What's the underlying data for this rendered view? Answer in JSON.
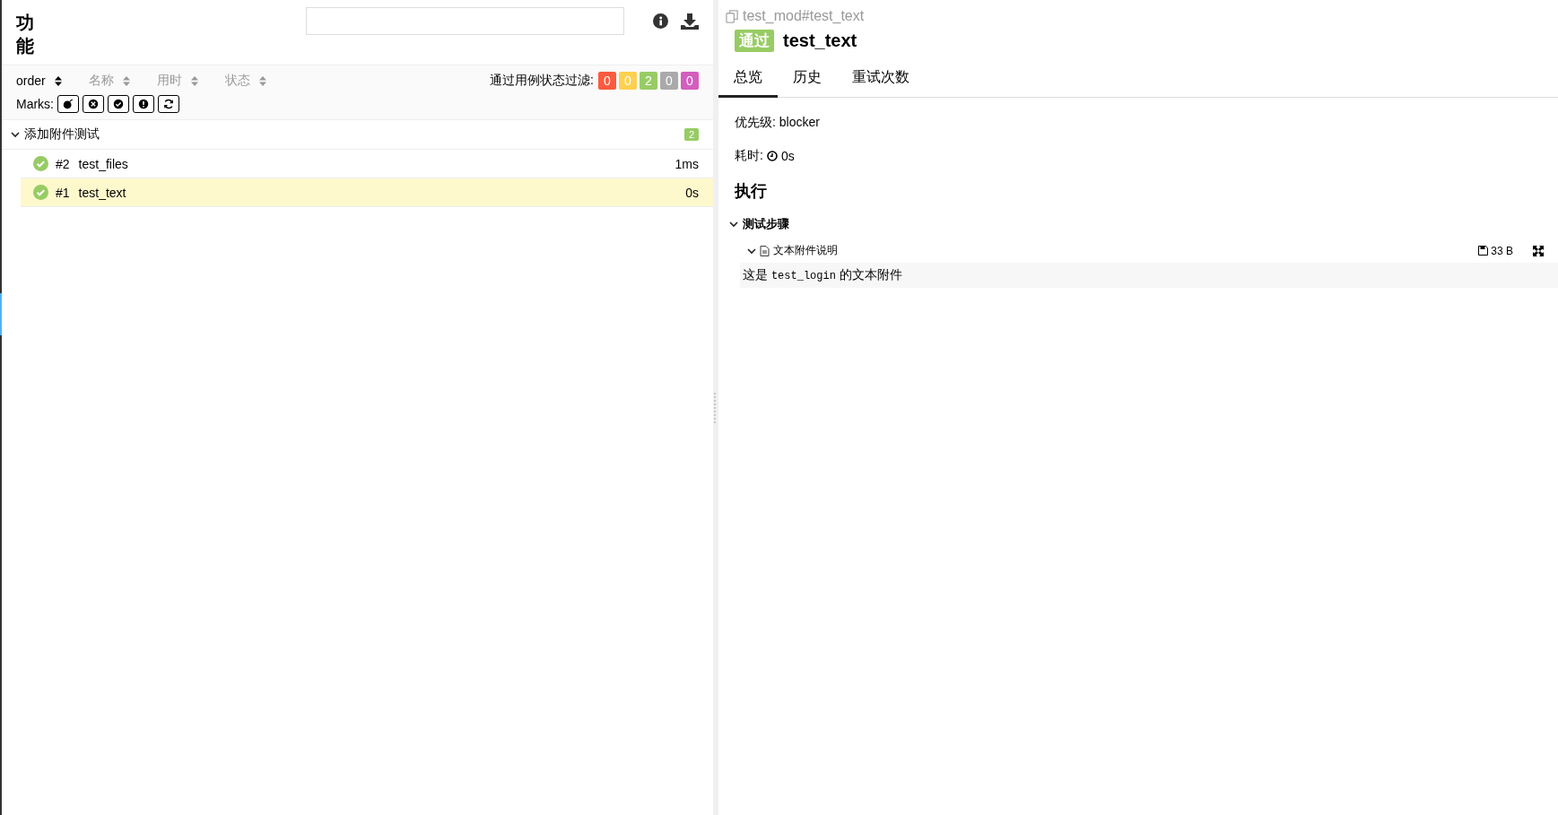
{
  "sidebar": {
    "title": "功能",
    "sort_columns": [
      {
        "label": "order",
        "selected": true
      },
      {
        "label": "名称",
        "selected": false
      },
      {
        "label": "用时",
        "selected": false
      },
      {
        "label": "状态",
        "selected": false
      }
    ],
    "filter": {
      "label": "通过用例状态过滤:",
      "counts": [
        {
          "value": "0",
          "color": "#fd5a3e"
        },
        {
          "value": "0",
          "color": "#ffd050"
        },
        {
          "value": "2",
          "color": "#97cc64"
        },
        {
          "value": "0",
          "color": "#aaaaaa"
        },
        {
          "value": "0",
          "color": "#d35ebe"
        }
      ]
    },
    "marks_label": "Marks:",
    "groups": [
      {
        "name": "添加附件测试",
        "expanded": true,
        "count": "2",
        "cases": [
          {
            "order": "#2",
            "name": "test_files",
            "duration": "1ms",
            "kind": "passed",
            "selected": false
          },
          {
            "order": "#1",
            "name": "test_text",
            "duration": "0s",
            "kind": "passed",
            "selected": true
          }
        ]
      }
    ]
  },
  "detail": {
    "path": "test_mod#test_text",
    "status_label": "通过",
    "kind": "passed",
    "title": "test_text",
    "tabs": [
      {
        "label": "总览",
        "selected": true
      },
      {
        "label": "历史",
        "selected": false
      },
      {
        "label": "重试次数",
        "selected": false
      }
    ],
    "priority": "优先级: blocker",
    "duration_label": "耗时:",
    "duration": "0s",
    "section": "执行",
    "steps": {
      "title": "测试步骤",
      "expanded": true,
      "attachment": {
        "name": "文本附件说明",
        "expanded": true,
        "size": "33 B",
        "content": [
          {
            "kind": "text",
            "text": "这是 "
          },
          {
            "kind": "code",
            "text": "test_login"
          },
          {
            "kind": "text",
            "text": " 的文本附件"
          }
        ]
      }
    }
  }
}
